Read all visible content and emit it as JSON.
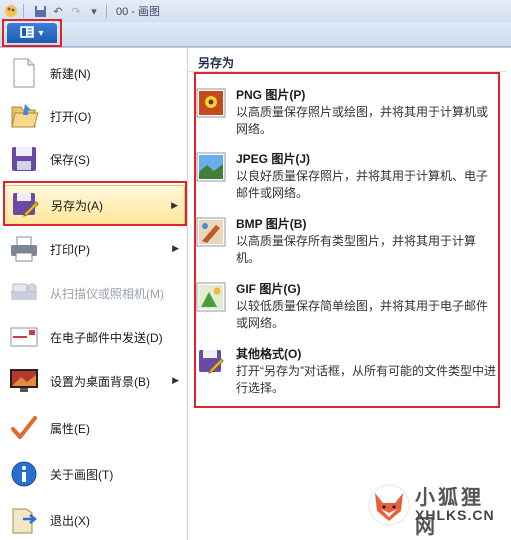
{
  "titlebar": {
    "title": "00 - 画图",
    "icons": [
      "paint-app-icon",
      "save-icon",
      "undo-icon",
      "redo-icon",
      "dropdown-icon"
    ]
  },
  "app_button": {
    "icon": "menu-document-icon",
    "arrow": "▾"
  },
  "menu": {
    "items": [
      {
        "label": "新建(N)",
        "icon": "new-file-icon"
      },
      {
        "label": "打开(O)",
        "icon": "open-folder-icon"
      },
      {
        "label": "保存(S)",
        "icon": "floppy-disk-icon"
      },
      {
        "label": "另存为(A)",
        "icon": "save-as-icon",
        "has_submenu": true,
        "selected": true
      },
      {
        "label": "打印(P)",
        "icon": "printer-icon",
        "has_submenu": true
      },
      {
        "label": "从扫描仪或照相机(M)",
        "icon": "scanner-icon",
        "disabled": true
      },
      {
        "label": "在电子邮件中发送(D)",
        "icon": "email-icon"
      },
      {
        "label": "设置为桌面背景(B)",
        "icon": "desktop-background-icon",
        "has_submenu": true
      },
      {
        "label": "属性(E)",
        "icon": "checkmark-icon"
      },
      {
        "label": "关于画图(T)",
        "icon": "info-icon"
      },
      {
        "label": "退出(X)",
        "icon": "exit-icon"
      }
    ]
  },
  "saveas_panel": {
    "heading": "另存为",
    "formats": [
      {
        "title": "PNG 图片(P)",
        "desc": "以高质量保存照片或绘图，并将其用于计算机或网络。",
        "icon": "png-image-icon"
      },
      {
        "title": "JPEG 图片(J)",
        "desc": "以良好质量保存照片，并将其用于计算机、电子邮件或网络。",
        "icon": "jpeg-image-icon"
      },
      {
        "title": "BMP 图片(B)",
        "desc": "以高质量保存所有类型图片，并将其用于计算机。",
        "icon": "bmp-image-icon"
      },
      {
        "title": "GIF 图片(G)",
        "desc": "以较低质量保存简单绘图，并将其用于电子邮件或网络。",
        "icon": "gif-image-icon"
      },
      {
        "title": "其他格式(O)",
        "desc": "打开“另存为”对话框，从所有可能的文件类型中进行选择。",
        "icon": "other-formats-icon"
      }
    ]
  },
  "watermark": {
    "cn": "小狐狸网",
    "en": "XHLKS.CN"
  },
  "colors": {
    "highlight": "#e0232b",
    "selected_bg": "#ffe69a",
    "app_button": "#1f5bb3"
  }
}
